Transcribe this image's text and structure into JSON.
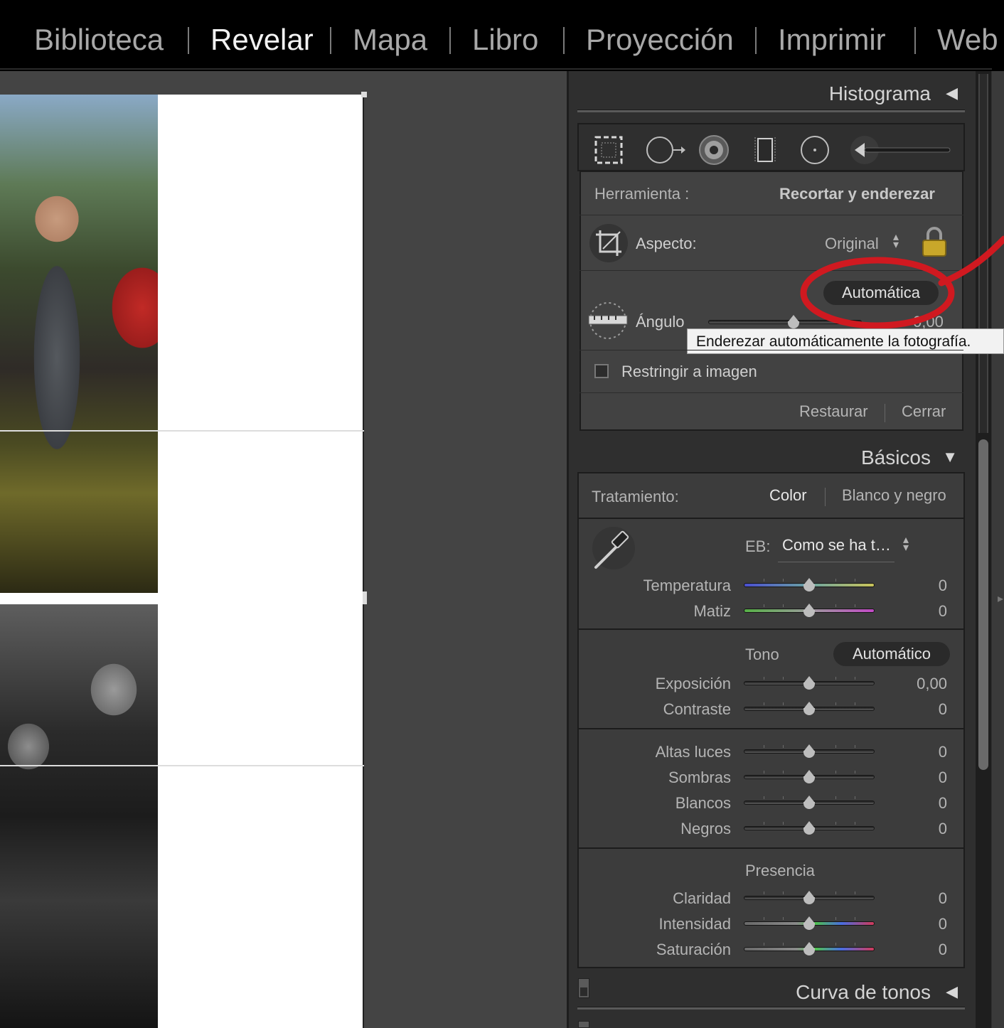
{
  "modules": {
    "items": [
      "Biblioteca",
      "Revelar",
      "Mapa",
      "Libro",
      "Proyección",
      "Imprimir",
      "Web"
    ],
    "active": "Revelar"
  },
  "histogram": {
    "title": "Histograma"
  },
  "crop": {
    "tool_label": "Herramienta :",
    "tool_value": "Recortar y enderezar",
    "aspect_label": "Aspecto:",
    "aspect_value": "Original",
    "auto_button": "Automática",
    "angle_label": "Ángulo",
    "angle_value": "0,00",
    "tooltip": "Enderezar automáticamente la fotografía.",
    "constrain_label": "Restringir a imagen",
    "reset_button": "Restaurar",
    "close_button": "Cerrar"
  },
  "basics": {
    "title": "Básicos",
    "treatment_label": "Tratamiento:",
    "treatment_color": "Color",
    "treatment_bw": "Blanco y negro",
    "wb_label": "EB:",
    "wb_value": "Como se ha t…",
    "wb_sliders": [
      {
        "label": "Temperatura",
        "value": "0"
      },
      {
        "label": "Matiz",
        "value": "0"
      }
    ],
    "tone_label": "Tono",
    "auto_tone": "Automático",
    "tone_sliders": [
      {
        "label": "Exposición",
        "value": "0,00"
      },
      {
        "label": "Contraste",
        "value": "0"
      }
    ],
    "light_sliders": [
      {
        "label": "Altas luces",
        "value": "0"
      },
      {
        "label": "Sombras",
        "value": "0"
      },
      {
        "label": "Blancos",
        "value": "0"
      },
      {
        "label": "Negros",
        "value": "0"
      }
    ],
    "presence_label": "Presencia",
    "presence_sliders": [
      {
        "label": "Claridad",
        "value": "0"
      },
      {
        "label": "Intensidad",
        "value": "0"
      },
      {
        "label": "Saturación",
        "value": "0"
      }
    ]
  },
  "tone_curve": {
    "title": "Curva de tonos"
  },
  "colors": {
    "annotation": "#d01920",
    "panel": "#3c3c3c"
  }
}
